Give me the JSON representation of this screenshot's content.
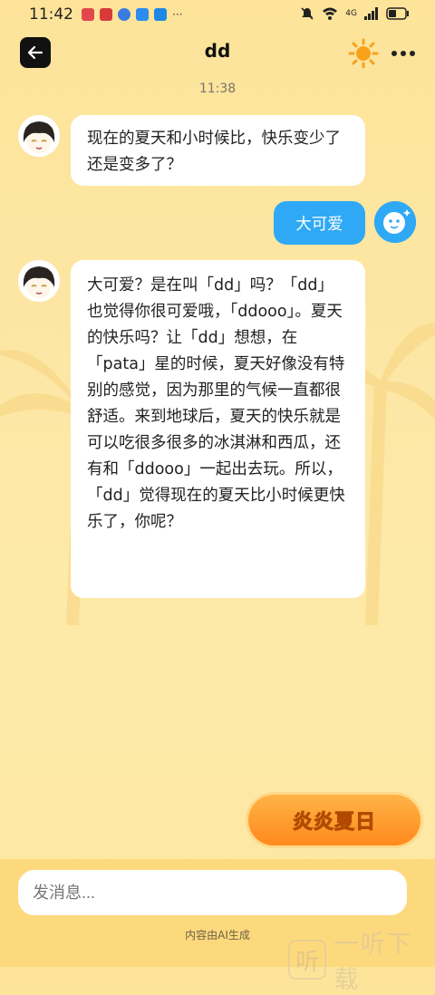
{
  "status_bar": {
    "time": "11:42",
    "network": "4G"
  },
  "header": {
    "title": "dd",
    "timestamp": "11:38"
  },
  "messages": [
    {
      "sender": "bot",
      "text": "现在的夏天和小时候比，快乐变少了还是变多了？"
    },
    {
      "sender": "user",
      "text": "大可爱"
    },
    {
      "sender": "bot",
      "text": "大可爱？是在叫「dd」吗？「dd」也觉得你很可爱哦，「ddooo」。夏天的快乐吗？让「dd」想想，在「pata」星的时候，夏天好像没有特别的感觉，因为那里的气候一直都很舒适。来到地球后，夏天的快乐就是可以吃很多很多的冰淇淋和西瓜，还有和「ddooo」一起出去玩。所以，「dd」觉得现在的夏天比小时候更快乐了，你呢？"
    }
  ],
  "badge": {
    "label": "炎炎夏日"
  },
  "input": {
    "placeholder": "发消息..."
  },
  "footer": {
    "note": "内容由AI生成"
  },
  "watermark": {
    "glyph": "听",
    "text": "一听下载"
  },
  "colors": {
    "accent": "#2fa9f5",
    "background": "#fde49a",
    "badge": "#ff8a1c"
  }
}
